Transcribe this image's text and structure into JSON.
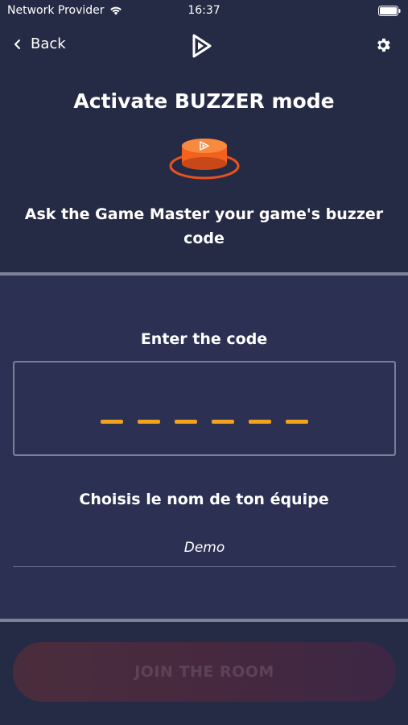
{
  "status_bar": {
    "carrier": "Network Provider",
    "time": "16:37"
  },
  "nav": {
    "back_label": "Back",
    "logo_icon": "play-logo-icon",
    "settings_icon": "gear-icon"
  },
  "main": {
    "title": "Activate BUZZER mode",
    "buzzer_icon": "buzzer-icon",
    "subtitle": "Ask the Game Master your game's buzzer code"
  },
  "code_entry": {
    "label": "Enter the code",
    "slots": 6
  },
  "team": {
    "label": "Choisis le nom de ton équipe",
    "value": "Demo"
  },
  "footer": {
    "join_label": "JOIN THE ROOM"
  },
  "colors": {
    "background": "#262b45",
    "panel": "#2c3153",
    "accent": "#f3a21c",
    "buzzer": "#f2621e"
  }
}
